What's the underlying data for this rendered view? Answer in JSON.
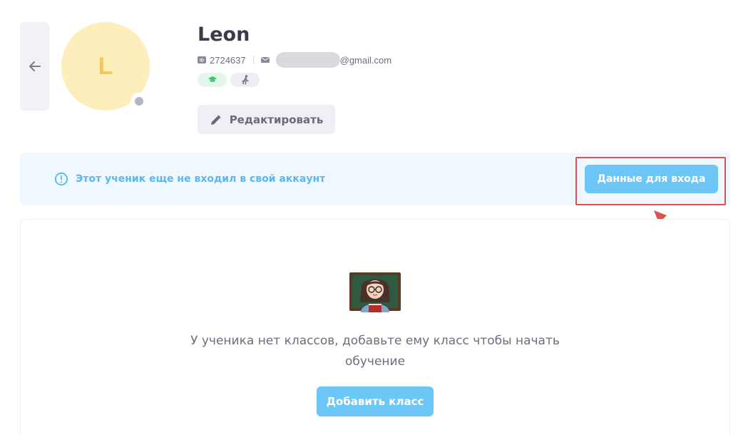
{
  "profile": {
    "avatar_letter": "L",
    "name": "Leon",
    "id_value": "2724637",
    "email_suffix": "@gmail.com",
    "badges": [
      {
        "icon": "graduation-cap-icon",
        "color": "#3cc46f"
      },
      {
        "icon": "running-person-icon",
        "color": "#6b6a7b"
      }
    ],
    "edit_label": "Редактировать"
  },
  "notice": {
    "text": "Этот ученик еще не входил в свой аккаунт",
    "icon": "info-circle-icon",
    "button_label": "Данные для входа"
  },
  "empty_state": {
    "icon": "teacher-emoji-icon",
    "message": "У ученика нет классов, добавьте ему класс чтобы начать обучение",
    "button_label": "Добавить класс"
  },
  "colors": {
    "accent": "#6dc7f6",
    "notice_bg": "#eff8fe",
    "notice_text": "#5bb8ef",
    "avatar_bg": "#fdeebb",
    "highlight": "#d9534f"
  }
}
